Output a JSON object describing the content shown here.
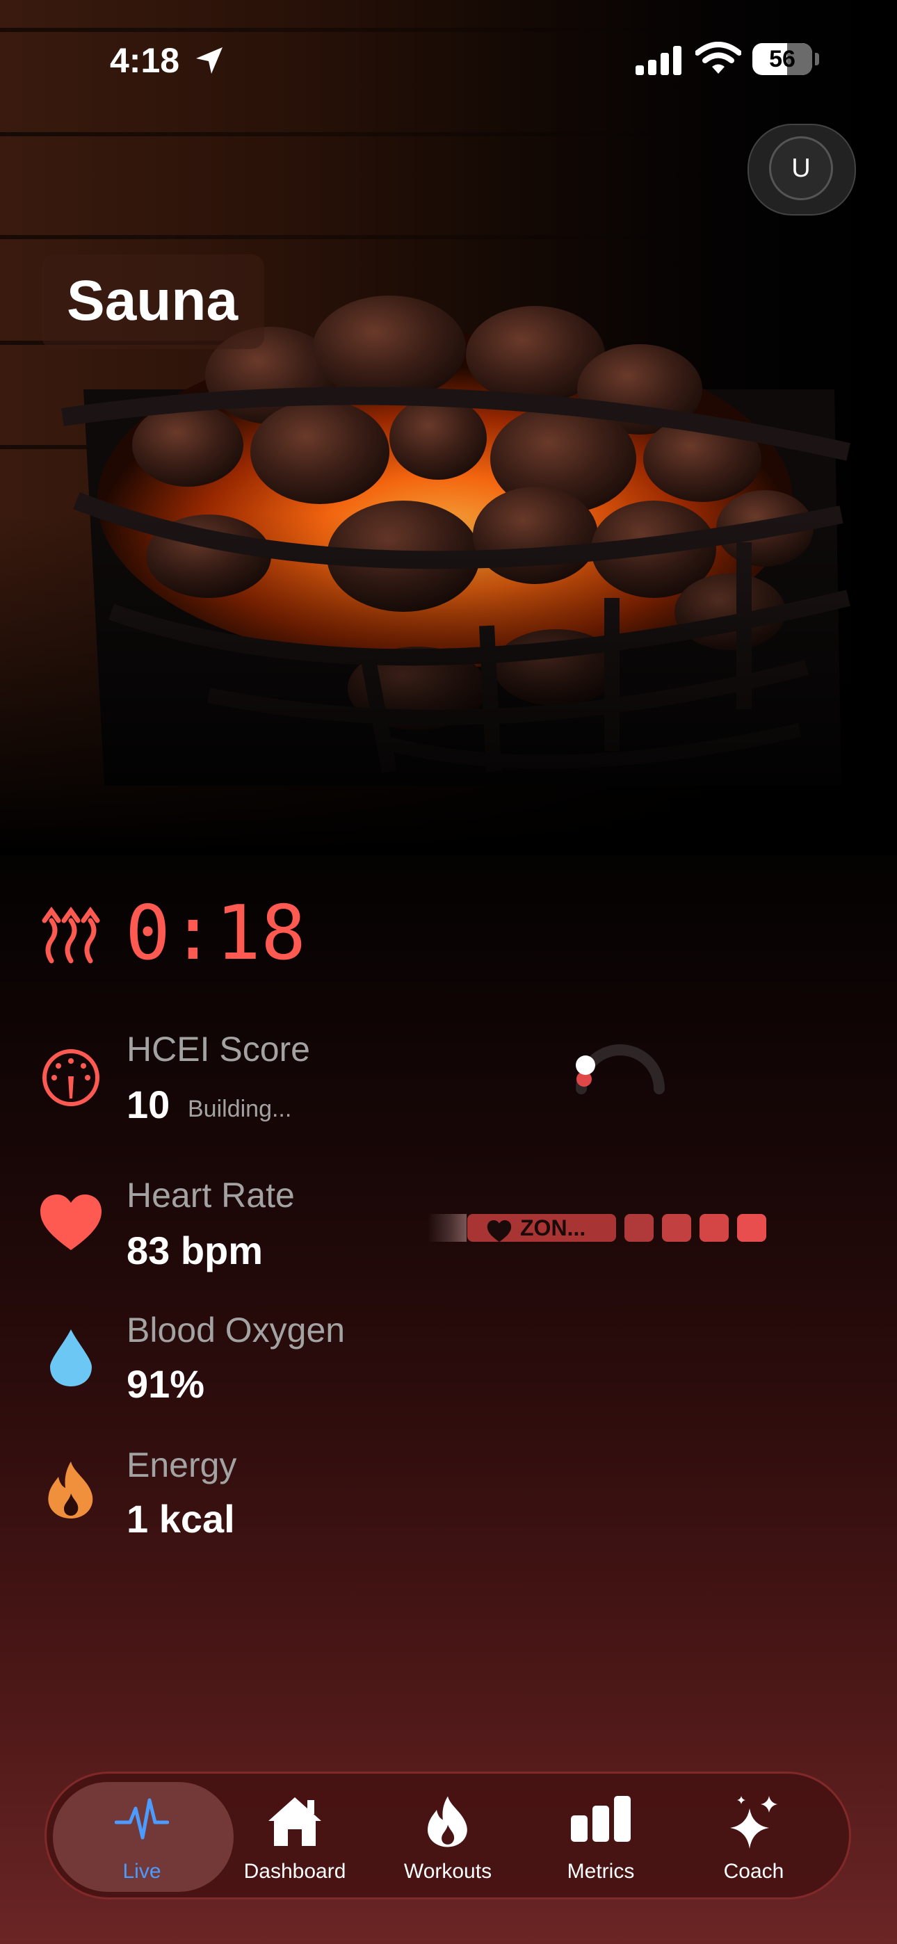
{
  "status_bar": {
    "time": "4:18",
    "battery_level": "56"
  },
  "header": {
    "title": "Sauna",
    "avatar_initial": "U"
  },
  "timer": {
    "value": "0:18",
    "icon": "heat-waves-icon",
    "color": "#ff5a52"
  },
  "metrics": [
    {
      "icon": "gauge-icon",
      "label": "HCEI Score",
      "value": "10",
      "sub": "Building...",
      "color": "#ff5a52"
    },
    {
      "icon": "heart-icon",
      "label": "Heart Rate",
      "value": "83 bpm",
      "color": "#ff5a52"
    },
    {
      "icon": "water-drop-icon",
      "label": "Blood Oxygen",
      "value": "91%",
      "color": "#6cc7f5"
    },
    {
      "icon": "flame-icon",
      "label": "Energy",
      "value": "1 kcal",
      "color": "#f0903c"
    }
  ],
  "zone": {
    "label": "ZON...",
    "accent": "#a83434"
  },
  "tabs": [
    {
      "label": "Live",
      "icon": "heartbeat-icon",
      "active": true
    },
    {
      "label": "Dashboard",
      "icon": "house-icon",
      "active": false
    },
    {
      "label": "Workouts",
      "icon": "flame-icon",
      "active": false
    },
    {
      "label": "Metrics",
      "icon": "bar-chart-icon",
      "active": false
    },
    {
      "label": "Coach",
      "icon": "sparkles-icon",
      "active": false
    }
  ],
  "colors": {
    "active_tab": "#4c9cff",
    "accent_red": "#ff5a52"
  }
}
